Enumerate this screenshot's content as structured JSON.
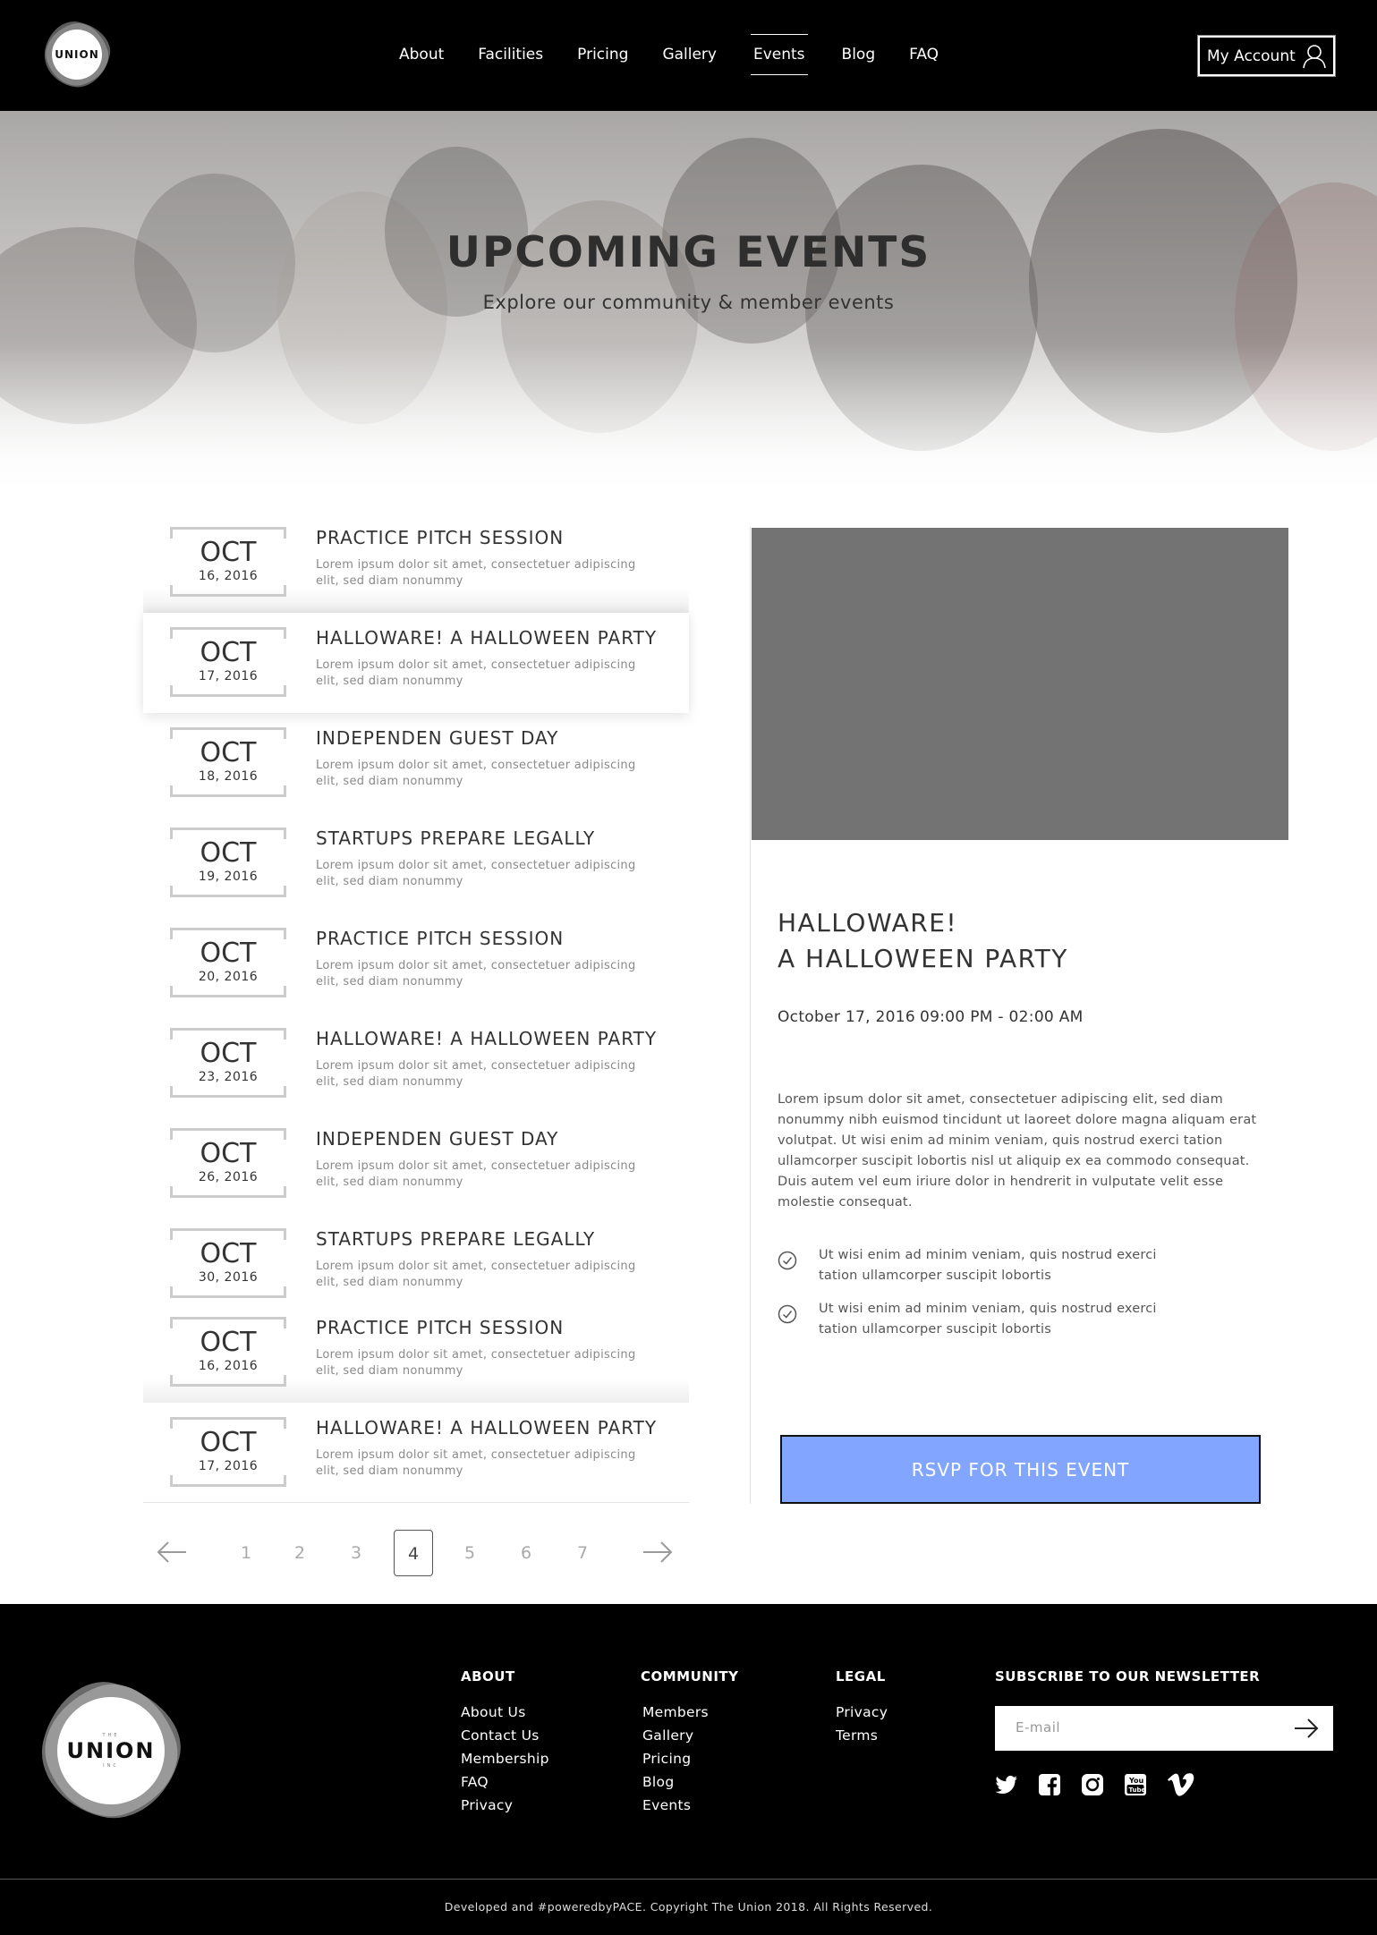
{
  "header": {
    "logo_text": "UNION",
    "nav": [
      {
        "label": "About",
        "active": false
      },
      {
        "label": "Facilities",
        "active": false
      },
      {
        "label": "Pricing",
        "active": false
      },
      {
        "label": "Gallery",
        "active": false
      },
      {
        "label": "Events",
        "active": true
      },
      {
        "label": "Blog",
        "active": false
      },
      {
        "label": "FAQ",
        "active": false
      }
    ],
    "account_label": "My Account",
    "account_icon": "user-icon"
  },
  "hero": {
    "title": "UPCOMING EVENTS",
    "subtitle": "Explore our community & member events"
  },
  "events": [
    {
      "month": "OCT",
      "day": "16, 2016",
      "title": "PRACTICE PITCH SESSION",
      "desc": "Lorem ipsum dolor sit amet, consectetuer adipiscing elit, sed diam nonummy"
    },
    {
      "month": "OCT",
      "day": "17, 2016",
      "title": "HALLOWARE! A HALLOWEEN PARTY",
      "desc": "Lorem ipsum dolor sit amet, consectetuer adipiscing elit, sed diam nonummy"
    },
    {
      "month": "OCT",
      "day": "18, 2016",
      "title": "INDEPENDEN GUEST DAY",
      "desc": "Lorem ipsum dolor sit amet, consectetuer adipiscing elit, sed diam nonummy"
    },
    {
      "month": "OCT",
      "day": "19, 2016",
      "title": "STARTUPS PREPARE LEGALLY",
      "desc": "Lorem ipsum dolor sit amet, consectetuer adipiscing elit, sed diam nonummy"
    },
    {
      "month": "OCT",
      "day": "20, 2016",
      "title": "PRACTICE PITCH SESSION",
      "desc": "Lorem ipsum dolor sit amet, consectetuer adipiscing elit, sed diam nonummy"
    },
    {
      "month": "OCT",
      "day": "23, 2016",
      "title": "HALLOWARE! A HALLOWEEN PARTY",
      "desc": "Lorem ipsum dolor sit amet, consectetuer adipiscing elit, sed diam nonummy"
    },
    {
      "month": "OCT",
      "day": "26, 2016",
      "title": "INDEPENDEN GUEST DAY",
      "desc": "Lorem ipsum dolor sit amet, consectetuer adipiscing elit, sed diam nonummy"
    },
    {
      "month": "OCT",
      "day": "30, 2016",
      "title": "STARTUPS PREPARE LEGALLY",
      "desc": "Lorem ipsum dolor sit amet, consectetuer adipiscing elit, sed diam nonummy"
    },
    {
      "month": "OCT",
      "day": "16, 2016",
      "title": "PRACTICE PITCH SESSION",
      "desc": "Lorem ipsum dolor sit amet, consectetuer adipiscing elit, sed diam nonummy"
    },
    {
      "month": "OCT",
      "day": "17, 2016",
      "title": "HALLOWARE! A HALLOWEEN PARTY",
      "desc": "Lorem ipsum dolor sit amet, consectetuer adipiscing elit, sed diam nonummy"
    }
  ],
  "pagination": {
    "pages": [
      "1",
      "2",
      "3",
      "4",
      "5",
      "6",
      "7"
    ],
    "current": "4",
    "prev_icon": "arrow-left-icon",
    "next_icon": "arrow-right-icon"
  },
  "detail": {
    "title_line1": "HALLOWARE!",
    "title_line2": "A HALLOWEEN PARTY",
    "date": "October 17, 2016",
    "time": "09:00 PM - 02:00 AM",
    "body": "Lorem ipsum dolor sit amet, consectetuer adipiscing elit, sed diam nonummy nibh euismod tincidunt ut laoreet dolore magna aliquam erat volutpat. Ut wisi enim ad minim veniam, quis nostrud exerci tation ullamcorper suscipit lobortis nisl ut aliquip ex ea commodo consequat. Duis autem vel eum iriure dolor in hendrerit in vulputate velit esse molestie consequat.",
    "bullets": [
      "Ut wisi enim ad minim veniam, quis nostrud exerci tation ullamcorper suscipit lobortis",
      "Ut wisi enim ad minim veniam, quis nostrud exerci tation ullamcorper suscipit lobortis"
    ],
    "rsvp_label": "RSVP FOR THIS EVENT",
    "rsvp_color": "#82a6ff"
  },
  "footer": {
    "logo_small_top": "THE",
    "logo_word": "UNION",
    "logo_small_bottom": "INC",
    "about": {
      "title": "ABOUT",
      "links": [
        "About Us",
        "Contact Us",
        "Membership",
        "FAQ",
        "Privacy"
      ]
    },
    "community": {
      "title": "COMMUNITY",
      "links": [
        "Members",
        "Gallery",
        "Pricing",
        "Blog",
        "Events"
      ]
    },
    "legal": {
      "title": "LEGAL",
      "links": [
        "Privacy",
        "Terms"
      ]
    },
    "newsletter": {
      "title": "SUBSCRIBE TO OUR NEWSLETTER",
      "placeholder": "E-mail",
      "submit_icon": "arrow-right-icon"
    },
    "social": [
      "twitter-icon",
      "facebook-icon",
      "instagram-icon",
      "youtube-icon",
      "vimeo-icon"
    ],
    "copyright": "Developed and #poweredbyPACE. Copyright The Union 2018. All Rights Reserved."
  }
}
